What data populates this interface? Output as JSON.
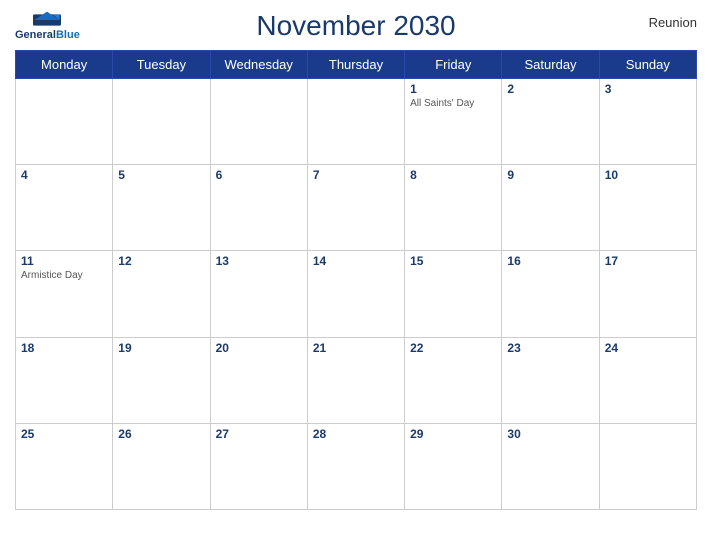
{
  "header": {
    "title": "November 2030",
    "region": "Reunion",
    "logo_general": "General",
    "logo_blue": "Blue"
  },
  "weekdays": [
    "Monday",
    "Tuesday",
    "Wednesday",
    "Thursday",
    "Friday",
    "Saturday",
    "Sunday"
  ],
  "weeks": [
    [
      {
        "day": "",
        "holiday": ""
      },
      {
        "day": "",
        "holiday": ""
      },
      {
        "day": "",
        "holiday": ""
      },
      {
        "day": "",
        "holiday": ""
      },
      {
        "day": "1",
        "holiday": "All Saints' Day"
      },
      {
        "day": "2",
        "holiday": ""
      },
      {
        "day": "3",
        "holiday": ""
      }
    ],
    [
      {
        "day": "4",
        "holiday": ""
      },
      {
        "day": "5",
        "holiday": ""
      },
      {
        "day": "6",
        "holiday": ""
      },
      {
        "day": "7",
        "holiday": ""
      },
      {
        "day": "8",
        "holiday": ""
      },
      {
        "day": "9",
        "holiday": ""
      },
      {
        "day": "10",
        "holiday": ""
      }
    ],
    [
      {
        "day": "11",
        "holiday": "Armistice Day"
      },
      {
        "day": "12",
        "holiday": ""
      },
      {
        "day": "13",
        "holiday": ""
      },
      {
        "day": "14",
        "holiday": ""
      },
      {
        "day": "15",
        "holiday": ""
      },
      {
        "day": "16",
        "holiday": ""
      },
      {
        "day": "17",
        "holiday": ""
      }
    ],
    [
      {
        "day": "18",
        "holiday": ""
      },
      {
        "day": "19",
        "holiday": ""
      },
      {
        "day": "20",
        "holiday": ""
      },
      {
        "day": "21",
        "holiday": ""
      },
      {
        "day": "22",
        "holiday": ""
      },
      {
        "day": "23",
        "holiday": ""
      },
      {
        "day": "24",
        "holiday": ""
      }
    ],
    [
      {
        "day": "25",
        "holiday": ""
      },
      {
        "day": "26",
        "holiday": ""
      },
      {
        "day": "27",
        "holiday": ""
      },
      {
        "day": "28",
        "holiday": ""
      },
      {
        "day": "29",
        "holiday": ""
      },
      {
        "day": "30",
        "holiday": ""
      },
      {
        "day": "",
        "holiday": ""
      }
    ]
  ]
}
